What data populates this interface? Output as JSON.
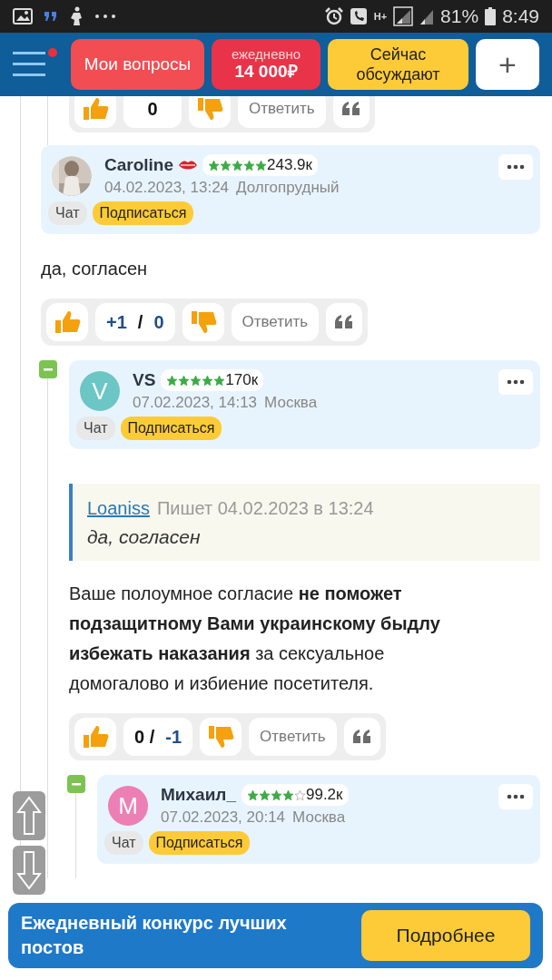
{
  "status_bar": {
    "network": "H+",
    "battery": "81%",
    "time": "8:49"
  },
  "header": {
    "menu_badge": true,
    "buttons": [
      {
        "kind": "red",
        "label": "Мои вопросы"
      },
      {
        "kind": "prize",
        "caption": "ежедневно",
        "label": "14 000₽"
      },
      {
        "kind": "yellow",
        "label": "Сейчас обсуждают"
      },
      {
        "kind": "plus",
        "label": "+"
      }
    ]
  },
  "partial_votes": {
    "score": [
      {
        "text": "0",
        "kind": "plain"
      }
    ],
    "reply": "Ответить"
  },
  "comments": [
    {
      "author": {
        "name": "Caroline",
        "sticker": true,
        "stars": 5,
        "rating": "243.9к",
        "date": "04.02.2023, 13:24",
        "city": "Долгопрудный",
        "chat": "Чат",
        "subscribe": "Подписаться"
      },
      "body": "да, согласен",
      "votes": {
        "score": [
          {
            "text": "+1",
            "kind": "accent"
          },
          {
            "text": "/",
            "kind": "plain"
          },
          {
            "text": "0",
            "kind": "accent"
          }
        ],
        "reply": "Ответить"
      },
      "children": [
        {
          "collapsed": false,
          "author": {
            "name": "VS",
            "avatar": {
              "kind": "letter",
              "letter": "V",
              "color": "#6cc6c6"
            },
            "stars": 5,
            "rating": "170к",
            "date": "07.02.2023, 14:13",
            "city": "Москва",
            "chat": "Чат",
            "subscribe": "Подписаться"
          },
          "quote": {
            "user": "Loaniss",
            "meta": "Пишет 04.02.2023 в 13:24",
            "text": "да, согласен"
          },
          "body": "Ваше полоумное согласие **не поможет подзащитному Вами украинскому быдлу избежать наказания** за сексуальное домогалово и избиение посетителя.",
          "votes": {
            "score": [
              {
                "text": "0 /",
                "kind": "plain"
              },
              {
                "text": "-1",
                "kind": "accent"
              }
            ],
            "reply": "Ответить"
          },
          "children": [
            {
              "collapsed": false,
              "author": {
                "name": "Михаил_",
                "avatar": {
                  "kind": "letter",
                  "letter": "M",
                  "color": "#ec7fb4"
                },
                "stars": 4,
                "rating": "99.2к",
                "date": "07.02.2023, 20:14",
                "city": "Москва",
                "chat": "Чат",
                "subscribe": "Подписаться"
              }
            }
          ]
        }
      ]
    }
  ],
  "banner": {
    "text": "Ежедневный конкурс лучших постов",
    "button": "Подробнее"
  }
}
